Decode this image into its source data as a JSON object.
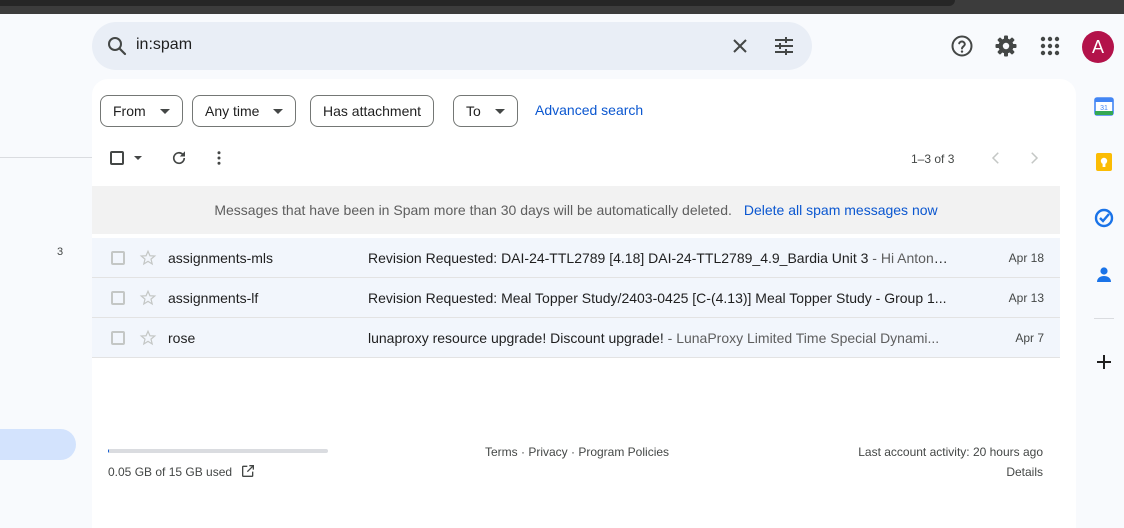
{
  "search": {
    "query": "in:spam"
  },
  "header": {
    "avatar_letter": "A"
  },
  "left_nav": {
    "count": "3"
  },
  "filters": [
    {
      "label": "From",
      "dropdown": true
    },
    {
      "label": "Any time",
      "dropdown": true
    },
    {
      "label": "Has attachment",
      "dropdown": false
    },
    {
      "label": "To",
      "dropdown": true
    }
  ],
  "advanced_search": "Advanced search",
  "pager": {
    "text": "1–3 of 3"
  },
  "notice": {
    "message": "Messages that have been in Spam more than 30 days will be automatically deleted.",
    "action": "Delete all spam messages now"
  },
  "emails": [
    {
      "sender": "assignments-mls",
      "subject": "Revision Requested: DAI-24-TTL2789 [4.18] DAI-24-TTL2789_4.9_Bardia Unit 3",
      "snippet": " - Hi Antony,...",
      "date": "Apr 18"
    },
    {
      "sender": "assignments-lf",
      "subject": "Revision Requested: Meal Topper Study/2403-0425 [C-(4.13)] Meal Topper Study - Group 1...",
      "snippet": "",
      "date": "Apr 13"
    },
    {
      "sender": "rose",
      "subject": "lunaproxy resource upgrade! Discount upgrade!",
      "snippet": " - LunaProxy Limited Time Special Dynami...",
      "date": "Apr 7"
    }
  ],
  "footer": {
    "storage_used": "0.05 GB of 15 GB used",
    "storage_fraction": 0.003,
    "links": "Terms · Privacy · Program Policies",
    "last_activity": "Last account activity: 20 hours ago",
    "details": "Details"
  },
  "colors": {
    "accent": "#0b57d0",
    "avatar": "#b3124a"
  }
}
